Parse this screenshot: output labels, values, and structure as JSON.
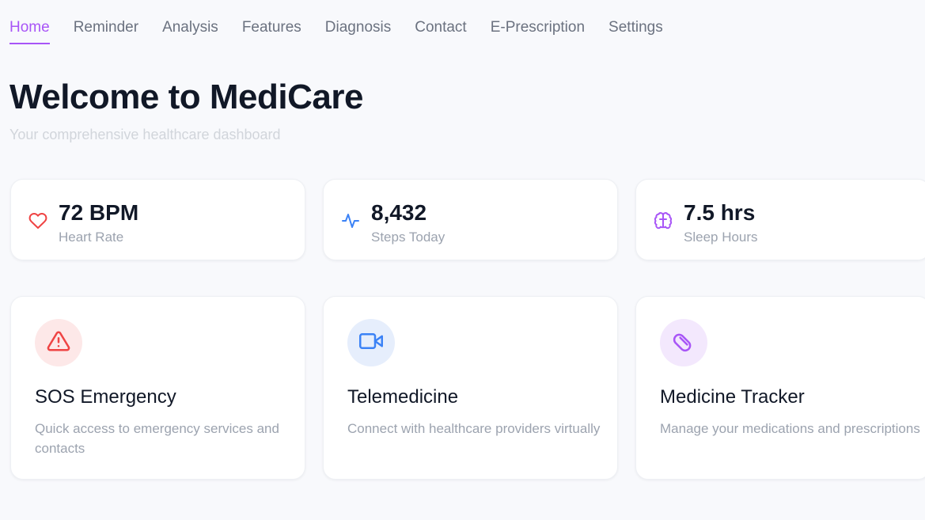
{
  "nav": {
    "items": [
      {
        "label": "Home"
      },
      {
        "label": "Reminder"
      },
      {
        "label": "Analysis"
      },
      {
        "label": "Features"
      },
      {
        "label": "Diagnosis"
      },
      {
        "label": "Contact"
      },
      {
        "label": "E-Prescription"
      },
      {
        "label": "Settings"
      }
    ],
    "active": "Home"
  },
  "header": {
    "title": "Welcome to MediCare",
    "subtitle": "Your comprehensive healthcare dashboard"
  },
  "stats": [
    {
      "value": "72 BPM",
      "label": "Heart Rate",
      "icon": "heart-icon",
      "color": "#ef4444"
    },
    {
      "value": "8,432",
      "label": "Steps Today",
      "icon": "activity-icon",
      "color": "#3b82f6"
    },
    {
      "value": "7.5 hrs",
      "label": "Sleep Hours",
      "icon": "brain-icon",
      "color": "#a855f7"
    }
  ],
  "features": [
    {
      "title": "SOS Emergency",
      "description": "Quick access to emergency services and contacts",
      "icon": "alert-triangle-icon",
      "color": "#ef4444",
      "bg": "#fde8e8"
    },
    {
      "title": "Telemedicine",
      "description": "Connect with healthcare providers virtually",
      "icon": "video-icon",
      "color": "#3b82f6",
      "bg": "#e6eefc"
    },
    {
      "title": "Medicine Tracker",
      "description": "Manage your medications and prescriptions",
      "icon": "pill-icon",
      "color": "#a855f7",
      "bg": "#f3e8fd"
    }
  ],
  "colors": {
    "accent": "#a855f7",
    "background": "#f8f9fc"
  }
}
